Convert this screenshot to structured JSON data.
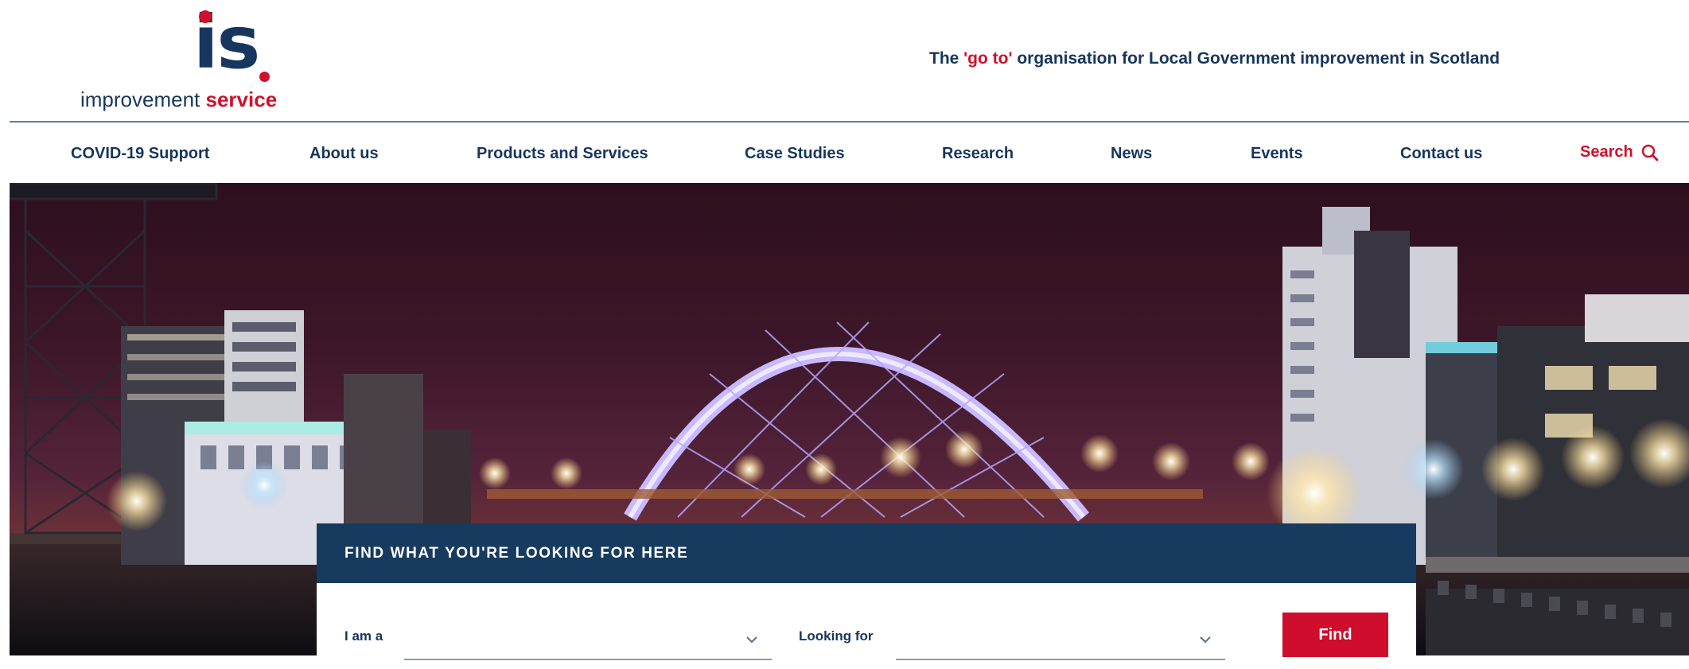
{
  "brand": {
    "logo_mark": "is",
    "logo_word_1": "improvement",
    "logo_word_2": "service",
    "tagline_pre": "The ",
    "tagline_highlight": "'go to'",
    "tagline_post": " organisation for Local Government improvement in Scotland",
    "colors": {
      "navy": "#17365d",
      "red": "#d0112b",
      "finder_bar": "#163b5e",
      "button": "#cf0d2d"
    }
  },
  "nav": {
    "items": [
      {
        "label": "COVID-19 Support"
      },
      {
        "label": "About us"
      },
      {
        "label": "Products and Services"
      },
      {
        "label": "Case Studies"
      },
      {
        "label": "Research"
      },
      {
        "label": "News"
      },
      {
        "label": "Events"
      },
      {
        "label": "Contact us"
      }
    ],
    "search_label": "Search",
    "search_icon": "search-icon"
  },
  "hero": {
    "image": "glasgow-clyde-arc-night-skyline"
  },
  "finder": {
    "title": "FIND WHAT YOU'RE LOOKING FOR HERE",
    "i_am_label": "I am a",
    "i_am_value": "",
    "looking_for_label": "Looking for",
    "looking_for_value": "",
    "dropdown_icon": "chevron-down-icon",
    "find_label": "Find"
  }
}
